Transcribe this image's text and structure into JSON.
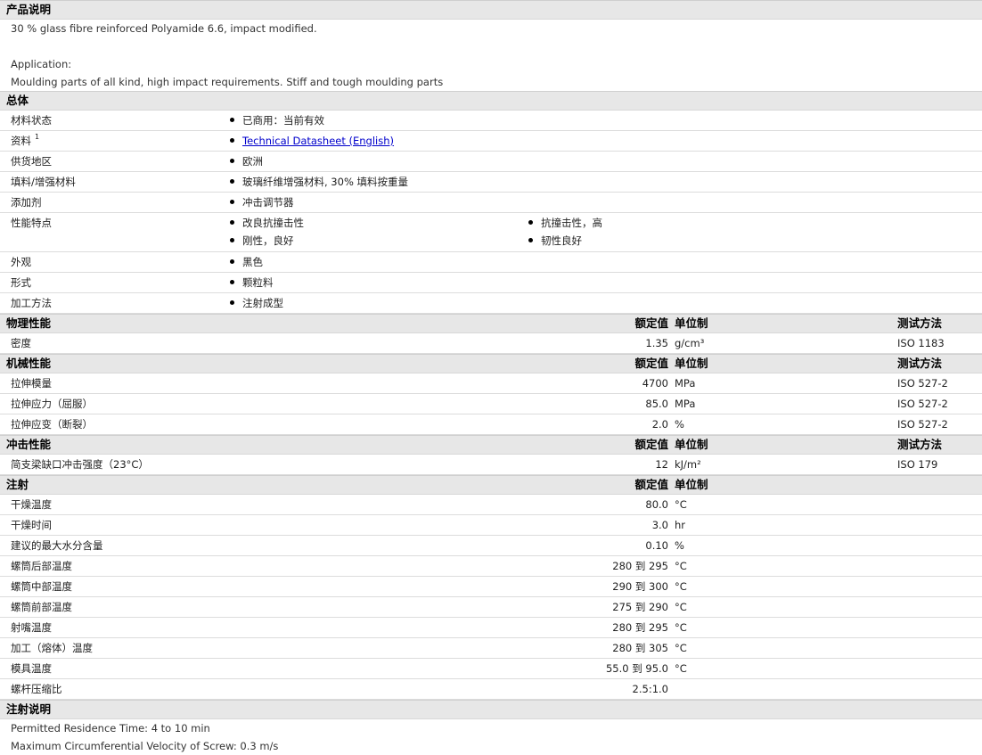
{
  "product_desc": {
    "title": "产品说明",
    "line1": "30 % glass fibre reinforced Polyamide 6.6, impact modified.",
    "app_label": "Application:",
    "app_text": "Moulding parts of all kind, high impact requirements. Stiff and tough moulding parts"
  },
  "general": {
    "title": "总体",
    "rows": [
      {
        "label": "材料状态",
        "values": [
          "已商用：当前有效"
        ]
      },
      {
        "label": "资料",
        "sup": "1",
        "link": "Technical Datasheet (English)"
      },
      {
        "label": "供货地区",
        "values": [
          "欧洲"
        ]
      },
      {
        "label": "填料/增强材料",
        "values": [
          "玻璃纤维增强材料, 30% 填料按重量"
        ]
      },
      {
        "label": "添加剂",
        "values": [
          "冲击调节器"
        ]
      },
      {
        "label": "性能特点",
        "values": [
          "改良抗撞击性",
          "抗撞击性，高",
          "刚性，良好",
          "韧性良好"
        ]
      },
      {
        "label": "外观",
        "values": [
          "黑色"
        ]
      },
      {
        "label": "形式",
        "values": [
          "颗粒料"
        ]
      },
      {
        "label": "加工方法",
        "values": [
          "注射成型"
        ]
      }
    ]
  },
  "col_headers": {
    "value": "额定值",
    "unit": "单位制",
    "method": "测试方法"
  },
  "physical": {
    "title": "物理性能",
    "rows": [
      {
        "label": "密度",
        "value": "1.35",
        "unit": "g/cm³",
        "method": "ISO 1183"
      }
    ]
  },
  "mechanical": {
    "title": "机械性能",
    "rows": [
      {
        "label": "拉伸模量",
        "value": "4700",
        "unit": "MPa",
        "method": "ISO 527-2"
      },
      {
        "label": "拉伸应力（屈服）",
        "value": "85.0",
        "unit": "MPa",
        "method": "ISO 527-2"
      },
      {
        "label": "拉伸应变（断裂）",
        "value": "2.0",
        "unit": "%",
        "method": "ISO 527-2"
      }
    ]
  },
  "impact": {
    "title": "冲击性能",
    "rows": [
      {
        "label": "简支梁缺口冲击强度（23°C）",
        "value": "12",
        "unit": "kJ/m²",
        "method": "ISO 179"
      }
    ]
  },
  "injection": {
    "title": "注射",
    "rows": [
      {
        "label": "干燥温度",
        "value": "80.0",
        "unit": "°C"
      },
      {
        "label": "干燥时间",
        "value": "3.0",
        "unit": "hr"
      },
      {
        "label": "建议的最大水分含量",
        "value": "0.10",
        "unit": "%"
      },
      {
        "label": "螺筒后部温度",
        "value": "280 到  295",
        "unit": "°C"
      },
      {
        "label": "螺筒中部温度",
        "value": "290 到  300",
        "unit": "°C"
      },
      {
        "label": "螺筒前部温度",
        "value": "275 到  290",
        "unit": "°C"
      },
      {
        "label": "射嘴温度",
        "value": "280 到  295",
        "unit": "°C"
      },
      {
        "label": "加工（熔体）温度",
        "value": "280 到  305",
        "unit": "°C"
      },
      {
        "label": "模具温度",
        "value": "55.0 到  95.0",
        "unit": "°C"
      },
      {
        "label": "螺杆压缩比",
        "value": "2.5:1.0",
        "unit": ""
      }
    ]
  },
  "inj_notes": {
    "title": "注射说明",
    "line1": "Permitted Residence Time: 4 to 10 min",
    "line2": "Maximum Circumferential Velocity of Screw: 0.3 m/s"
  }
}
